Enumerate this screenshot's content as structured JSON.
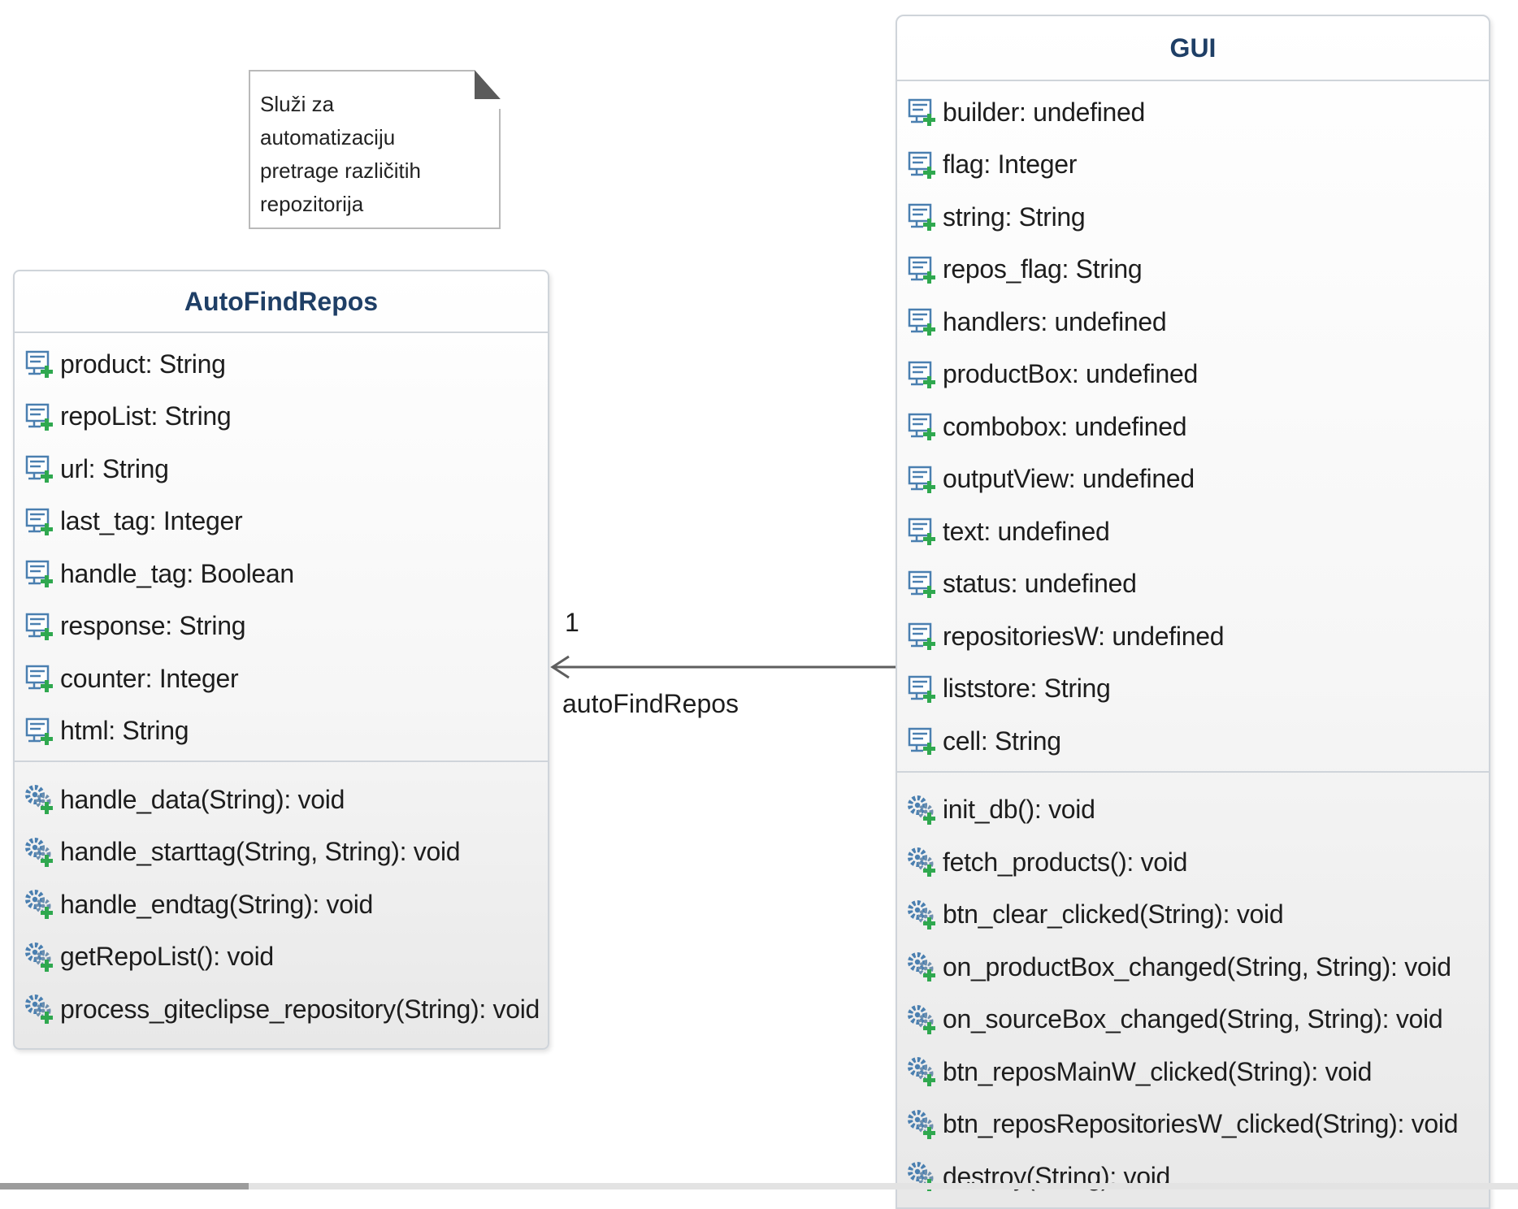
{
  "note": {
    "lines": [
      "Služi za automatizaciju",
      "pretrage različitih",
      "repozitorija"
    ]
  },
  "classes": {
    "auto": {
      "name": "AutoFindRepos",
      "attributes": [
        "product: String",
        "repoList: String",
        "url: String",
        "last_tag: Integer",
        "handle_tag: Boolean",
        "response: String",
        "counter: Integer",
        "html: String"
      ],
      "methods": [
        "handle_data(String): void",
        "handle_starttag(String, String): void",
        "handle_endtag(String): void",
        "getRepoList(): void",
        "process_giteclipse_repository(String): void"
      ]
    },
    "gui": {
      "name": "GUI",
      "attributes": [
        "builder: undefined",
        "flag: Integer",
        "string: String",
        "repos_flag: String",
        "handlers: undefined",
        "productBox: undefined",
        "combobox: undefined",
        "outputView: undefined",
        "text: undefined",
        "status: undefined",
        "repositoriesW: undefined",
        "liststore: String",
        "cell: String"
      ],
      "methods": [
        "init_db(): void",
        "fetch_products(): void",
        "btn_clear_clicked(String): void",
        "on_productBox_changed(String, String): void",
        "on_sourceBox_changed(String, String): void",
        "btn_reposMainW_clicked(String): void",
        "btn_reposRepositoriesW_clicked(String): void",
        "destroy(String): void"
      ]
    }
  },
  "association": {
    "multiplicity": "1",
    "role": "autoFindRepos"
  },
  "icons": {
    "attribute": "public-attribute-icon",
    "method": "public-operation-icon"
  },
  "colors": {
    "title": "#1f3f66",
    "border": "#cfd4da",
    "icon_green": "#2fa84f",
    "icon_blue": "#4a7fb0"
  }
}
